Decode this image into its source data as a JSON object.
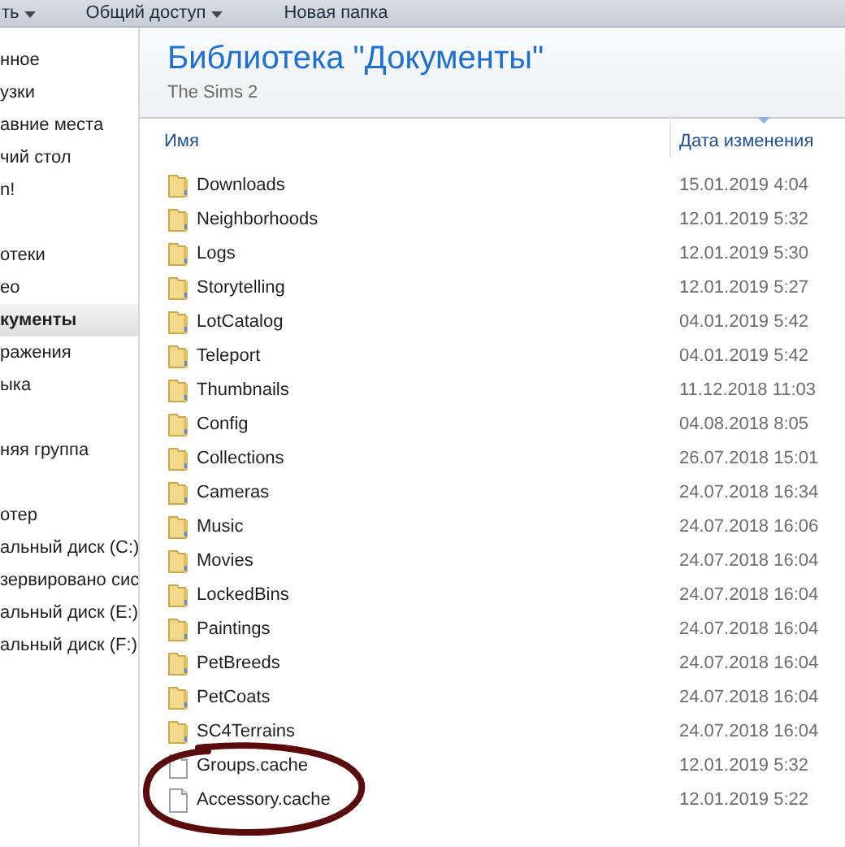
{
  "toolbar": {
    "items": [
      {
        "label": "ть",
        "caret": true
      },
      {
        "label": "Общий доступ",
        "caret": true
      },
      {
        "label": "Новая папка",
        "caret": false
      }
    ]
  },
  "sidebar": {
    "groups": [
      {
        "items": [
          {
            "label": "нное",
            "selected": false
          },
          {
            "label": "узки",
            "selected": false
          },
          {
            "label": "авние места",
            "selected": false
          },
          {
            "label": "чий стол",
            "selected": false
          },
          {
            "label": "n!",
            "selected": false
          }
        ]
      },
      {
        "items": [
          {
            "label": "отеки",
            "selected": false
          },
          {
            "label": "ео",
            "selected": false
          },
          {
            "label": "кументы",
            "selected": true
          },
          {
            "label": "ражения",
            "selected": false
          },
          {
            "label": "ыка",
            "selected": false
          }
        ]
      },
      {
        "items": [
          {
            "label": "няя группа",
            "selected": false
          }
        ]
      },
      {
        "items": [
          {
            "label": "отер",
            "selected": false
          },
          {
            "label": "альный диск (C:)",
            "selected": false
          },
          {
            "label": "зервировано сис",
            "selected": false
          },
          {
            "label": "альный диск (E:)",
            "selected": false
          },
          {
            "label": "альный диск (F:)",
            "selected": false
          }
        ]
      }
    ]
  },
  "library": {
    "title": "Библиотека \"Документы\"",
    "subtitle": "The Sims 2"
  },
  "table": {
    "columns": [
      {
        "label": "Имя",
        "sorted": false
      },
      {
        "label": "Дата изменения",
        "sorted": true
      }
    ],
    "rows": [
      {
        "kind": "folder",
        "name": "Downloads",
        "date": "15.01.2019 4:04"
      },
      {
        "kind": "folder",
        "name": "Neighborhoods",
        "date": "12.01.2019 5:32"
      },
      {
        "kind": "folder",
        "name": "Logs",
        "date": "12.01.2019 5:30"
      },
      {
        "kind": "folder",
        "name": "Storytelling",
        "date": "12.01.2019 5:27"
      },
      {
        "kind": "folder",
        "name": "LotCatalog",
        "date": "04.01.2019 5:42"
      },
      {
        "kind": "folder",
        "name": "Teleport",
        "date": "04.01.2019 5:42"
      },
      {
        "kind": "folder",
        "name": "Thumbnails",
        "date": "11.12.2018 11:03"
      },
      {
        "kind": "folder",
        "name": "Config",
        "date": "04.08.2018 8:05"
      },
      {
        "kind": "folder",
        "name": "Collections",
        "date": "26.07.2018 15:01"
      },
      {
        "kind": "folder",
        "name": "Cameras",
        "date": "24.07.2018 16:34"
      },
      {
        "kind": "folder",
        "name": "Music",
        "date": "24.07.2018 16:06"
      },
      {
        "kind": "folder",
        "name": "Movies",
        "date": "24.07.2018 16:04"
      },
      {
        "kind": "folder",
        "name": "LockedBins",
        "date": "24.07.2018 16:04"
      },
      {
        "kind": "folder",
        "name": "Paintings",
        "date": "24.07.2018 16:04"
      },
      {
        "kind": "folder",
        "name": "PetBreeds",
        "date": "24.07.2018 16:04"
      },
      {
        "kind": "folder",
        "name": "PetCoats",
        "date": "24.07.2018 16:04"
      },
      {
        "kind": "folder",
        "name": "SC4Terrains",
        "date": "24.07.2018 16:04"
      },
      {
        "kind": "file",
        "name": "Groups.cache",
        "date": "12.01.2019 5:32"
      },
      {
        "kind": "file",
        "name": "Accessory.cache",
        "date": "12.01.2019 5:22"
      }
    ]
  }
}
